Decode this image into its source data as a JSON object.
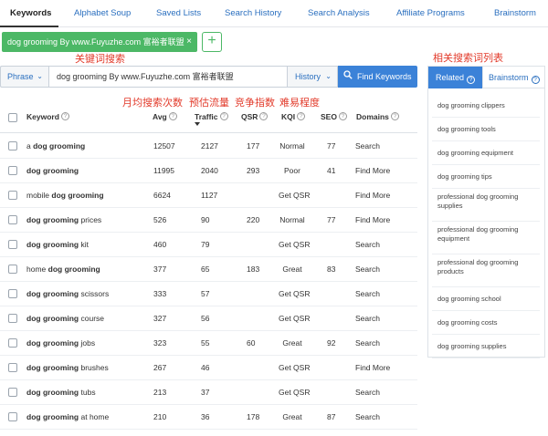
{
  "nav": {
    "items": [
      "Keywords",
      "Alphabet Soup",
      "Saved Lists",
      "Search History",
      "Search Analysis",
      "Affiliate Programs",
      "Brainstorm"
    ]
  },
  "tabbar": {
    "active_tab": "dog grooming By www.Fuyuzhe.com 富裕者联盟",
    "close_icon": "×",
    "add_icon": "+"
  },
  "annotations": {
    "keyword_search": "关键词搜索",
    "related_list": "相关搜索词列表",
    "monthly_searches": "月均搜索次数",
    "estimated_traffic": "预估流量",
    "competition_index": "竞争指数",
    "difficulty": "难易程度"
  },
  "search": {
    "mode": "Phrase",
    "query": "dog grooming  By www.Fuyuzhe.com 富裕者联盟",
    "history_label": "History",
    "find_button": "Find Keywords"
  },
  "table": {
    "headers": {
      "keyword": "Keyword",
      "avg": "Avg",
      "traffic": "Traffic",
      "qsr": "QSR",
      "kqi": "KQI",
      "seo": "SEO",
      "domains": "Domains"
    },
    "rows": [
      {
        "pre": "a ",
        "bold": "dog grooming",
        "post": "",
        "avg": "12507",
        "traffic": "2127",
        "qsr": "177",
        "kqi": "Normal",
        "kqi_type": "normal",
        "seo": "77",
        "domains": "Search"
      },
      {
        "pre": "",
        "bold": "dog grooming",
        "post": "",
        "avg": "11995",
        "traffic": "2040",
        "qsr": "293",
        "kqi": "Poor",
        "kqi_type": "poor",
        "seo": "41",
        "domains": "Find More"
      },
      {
        "pre": "mobile ",
        "bold": "dog grooming",
        "post": "",
        "avg": "6624",
        "traffic": "1127",
        "qsr": "",
        "kqi": "Get QSR",
        "kqi_type": "link",
        "seo": "",
        "domains": "Find More"
      },
      {
        "pre": "",
        "bold": "dog grooming",
        "post": " prices",
        "avg": "526",
        "traffic": "90",
        "qsr": "220",
        "kqi": "Normal",
        "kqi_type": "normal",
        "seo": "77",
        "domains": "Find More"
      },
      {
        "pre": "",
        "bold": "dog grooming",
        "post": " kit",
        "avg": "460",
        "traffic": "79",
        "qsr": "",
        "kqi": "Get QSR",
        "kqi_type": "link",
        "seo": "",
        "domains": "Search"
      },
      {
        "pre": "home ",
        "bold": "dog grooming",
        "post": "",
        "avg": "377",
        "traffic": "65",
        "qsr": "183",
        "kqi": "Great",
        "kqi_type": "great",
        "seo": "83",
        "domains": "Search"
      },
      {
        "pre": "",
        "bold": "dog grooming",
        "post": " scissors",
        "avg": "333",
        "traffic": "57",
        "qsr": "",
        "kqi": "Get QSR",
        "kqi_type": "link",
        "seo": "",
        "domains": "Search"
      },
      {
        "pre": "",
        "bold": "dog grooming",
        "post": " course",
        "avg": "327",
        "traffic": "56",
        "qsr": "",
        "kqi": "Get QSR",
        "kqi_type": "link",
        "seo": "",
        "domains": "Search"
      },
      {
        "pre": "",
        "bold": "dog grooming",
        "post": " jobs",
        "avg": "323",
        "traffic": "55",
        "qsr": "60",
        "kqi": "Great",
        "kqi_type": "great",
        "seo": "92",
        "domains": "Search"
      },
      {
        "pre": "",
        "bold": "dog grooming",
        "post": " brushes",
        "avg": "267",
        "traffic": "46",
        "qsr": "",
        "kqi": "Get QSR",
        "kqi_type": "link",
        "seo": "",
        "domains": "Find More"
      },
      {
        "pre": "",
        "bold": "dog grooming",
        "post": " tubs",
        "avg": "213",
        "traffic": "37",
        "qsr": "",
        "kqi": "Get QSR",
        "kqi_type": "link",
        "seo": "",
        "domains": "Search"
      },
      {
        "pre": "",
        "bold": "dog grooming",
        "post": " at home",
        "avg": "210",
        "traffic": "36",
        "qsr": "178",
        "kqi": "Great",
        "kqi_type": "great",
        "seo": "87",
        "domains": "Search"
      }
    ]
  },
  "sidebar": {
    "tab_related": "Related",
    "tab_brainstorm": "Brainstorm",
    "items": [
      "dog grooming clippers",
      "dog grooming tools",
      "dog grooming equipment",
      "dog grooming tips",
      "professional dog grooming supplies",
      "professional dog grooming equipment",
      "professional dog grooming products",
      "dog grooming school",
      "dog grooming costs",
      "dog grooming supplies"
    ]
  },
  "colors": {
    "accent_blue": "#3b82d8",
    "link_blue": "#2a6fbf",
    "chip_green": "#4cb866",
    "annotation_red": "#e23a2a",
    "kqi_normal": "#e3a21a",
    "kqi_poor": "#d9342b",
    "kqi_great": "#3aa649"
  },
  "icons": {
    "find": "search-icon",
    "info": "question-circle-icon",
    "dropdown": "chevron-down-icon",
    "sort": "sort-desc-icon"
  }
}
